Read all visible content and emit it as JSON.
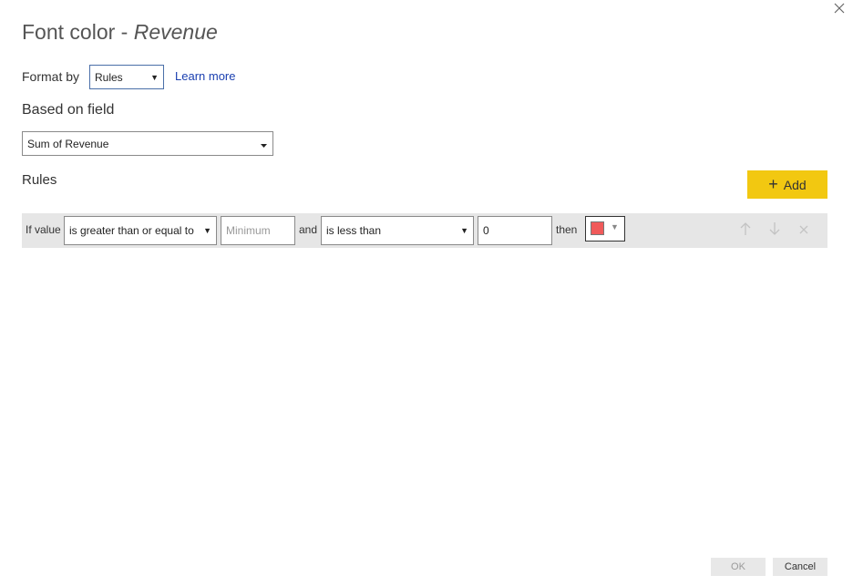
{
  "dialog": {
    "title": "Font color - ",
    "subtitle": "Revenue",
    "close_icon": "close-icon"
  },
  "format_by": {
    "label": "Format by",
    "selected": "Rules",
    "learn_more": "Learn more"
  },
  "based_on_field": {
    "label": "Based on field",
    "selected": "Sum of Revenue"
  },
  "rules": {
    "label": "Rules",
    "add_label": "Add",
    "items": [
      {
        "if_value_label": "If value",
        "condition1": "is greater than or equal to",
        "value1_placeholder": "Minimum",
        "value1": "",
        "and_label": "and",
        "condition2": "is less than",
        "value2": "0",
        "then_label": "then",
        "color": "#f05a5a"
      }
    ]
  },
  "footer": {
    "ok_label": "OK",
    "cancel_label": "Cancel"
  },
  "colors": {
    "accent_button": "#f2c811",
    "link": "#1a3fb0",
    "rule_row_bg": "#e6e6e6"
  }
}
